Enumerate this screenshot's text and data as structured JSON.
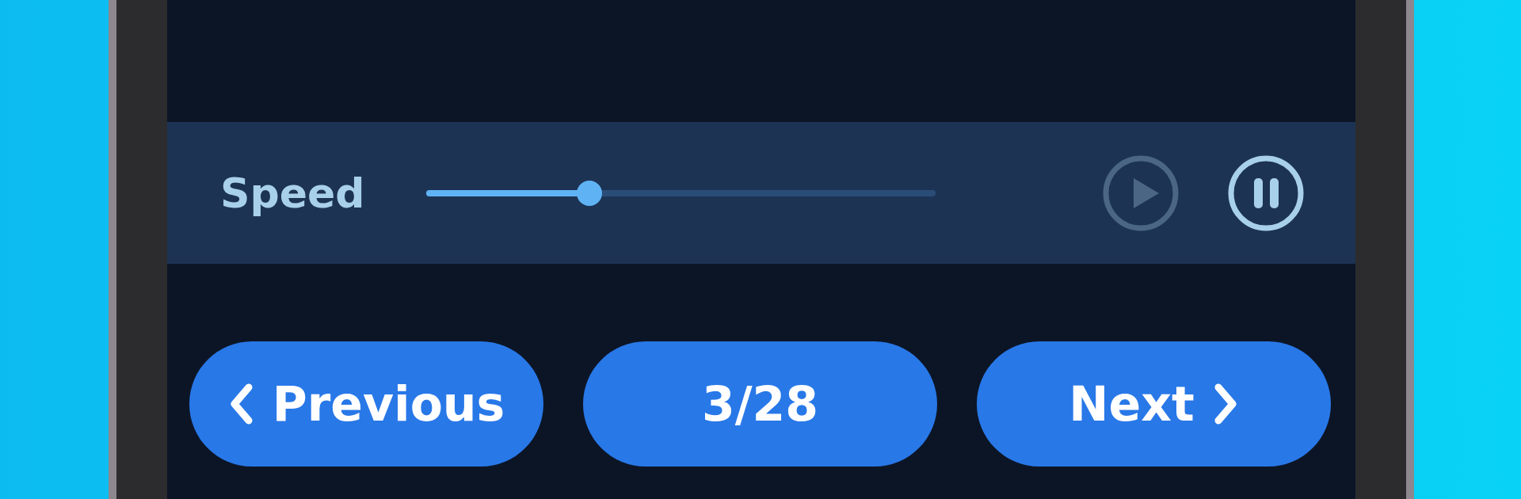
{
  "speed_panel": {
    "label": "Speed",
    "slider": {
      "level": 0.32
    },
    "controls": [
      {
        "kind": "play",
        "disabled": true
      },
      {
        "kind": "pause",
        "disabled": false
      }
    ]
  },
  "navigation": [
    {
      "kind": "previous",
      "label": "Previous"
    },
    {
      "kind": "counter",
      "label": "3/28"
    },
    {
      "kind": "next",
      "label": "Next"
    }
  ]
}
